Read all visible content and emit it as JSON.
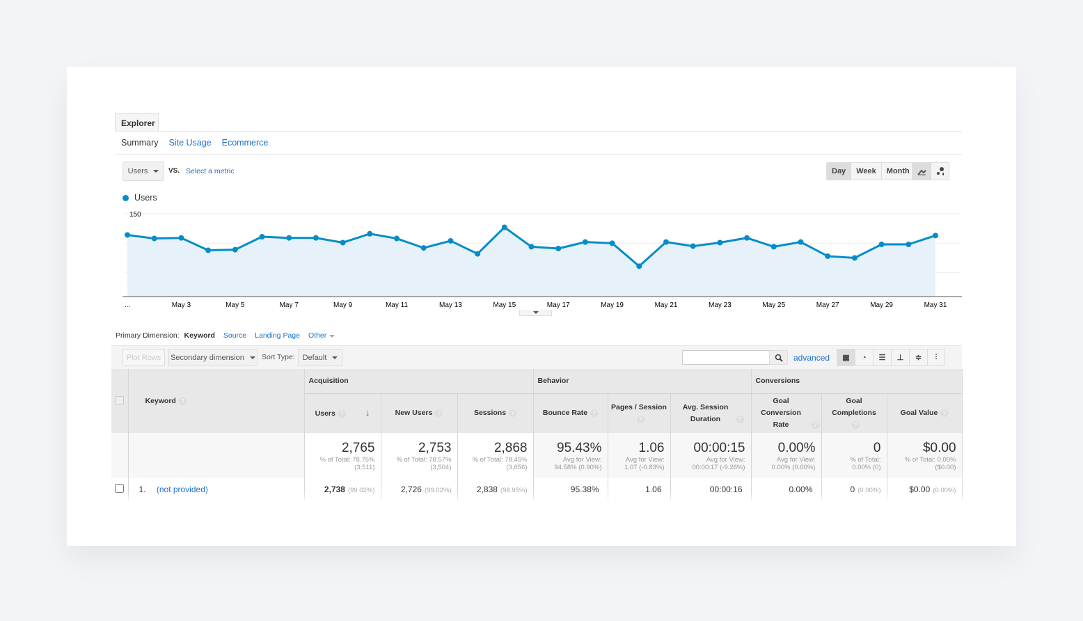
{
  "explorer_tab": "Explorer",
  "subtabs": {
    "summary": "Summary",
    "site_usage": "Site Usage",
    "ecommerce": "Ecommerce"
  },
  "metric": {
    "selected": "Users",
    "vs": "VS.",
    "select": "Select a metric"
  },
  "time": {
    "day": "Day",
    "week": "Week",
    "month": "Month",
    "active": "Day"
  },
  "chart_icons": [
    "line-chart-icon",
    "motion-chart-icon"
  ],
  "legend": "Users",
  "accent": "#058dc7",
  "chart_data": {
    "type": "area",
    "series": [
      {
        "name": "Users",
        "values": [
          114,
          108,
          109,
          88,
          89,
          111,
          109,
          109,
          101,
          116,
          108,
          92,
          104,
          82,
          127,
          94,
          91,
          102,
          100,
          61,
          102,
          95,
          101,
          109,
          94,
          102,
          78,
          75,
          98,
          98,
          113
        ]
      }
    ],
    "x": [
      "May 1",
      "May 2",
      "May 3",
      "May 4",
      "May 5",
      "May 6",
      "May 7",
      "May 8",
      "May 9",
      "May 10",
      "May 11",
      "May 12",
      "May 13",
      "May 14",
      "May 15",
      "May 16",
      "May 17",
      "May 18",
      "May 19",
      "May 20",
      "May 21",
      "May 22",
      "May 23",
      "May 24",
      "May 25",
      "May 26",
      "May 27",
      "May 28",
      "May 29",
      "May 30",
      "May 31"
    ],
    "x_tick_labels": [
      "...",
      "May 3",
      "May 5",
      "May 7",
      "May 9",
      "May 11",
      "May 13",
      "May 15",
      "May 17",
      "May 19",
      "May 21",
      "May 23",
      "May 25",
      "May 27",
      "May 29",
      "May 31"
    ],
    "y_ticks": [
      50,
      100,
      150
    ],
    "ylim": [
      0,
      150
    ],
    "grid": true,
    "legend": "top-left"
  },
  "dimension": {
    "label": "Primary Dimension:",
    "active": "Keyword",
    "options": [
      "Source",
      "Landing Page",
      "Other"
    ]
  },
  "toolbar": {
    "plot_rows": "Plot Rows",
    "secondary": "Secondary dimension",
    "sort_label": "Sort Type:",
    "sort_value": "Default",
    "search_placeholder": "",
    "advanced": "advanced",
    "view_icons": [
      "grid-view-icon",
      "pie-view-icon",
      "bar-view-icon",
      "comparison-view-icon",
      "term-cloud-icon",
      "pivot-view-icon"
    ]
  },
  "table": {
    "groups": {
      "acquisition": "Acquisition",
      "behavior": "Behavior",
      "conversions": "Conversions"
    },
    "dim_header": "Keyword",
    "columns": [
      "Users",
      "New Users",
      "Sessions",
      "Bounce Rate",
      "Pages / Session",
      "Avg. Session Duration",
      "Goal Conversion Rate",
      "Goal Completions",
      "Goal Value"
    ],
    "totals": [
      {
        "value": "2,765",
        "sub1": "% of Total: 78.75%",
        "sub2": "(3,511)"
      },
      {
        "value": "2,753",
        "sub1": "% of Total: 78.57%",
        "sub2": "(3,504)"
      },
      {
        "value": "2,868",
        "sub1": "% of Total: 78.45%",
        "sub2": "(3,656)"
      },
      {
        "value": "95.43%",
        "sub1": "Avg for View:",
        "sub2": "94.58% (0.90%)"
      },
      {
        "value": "1.06",
        "sub1": "Avg for View:",
        "sub2": "1.07 (-0.83%)"
      },
      {
        "value": "00:00:15",
        "sub1": "Avg for View:",
        "sub2": "00:00:17 (-9.26%)"
      },
      {
        "value": "0.00%",
        "sub1": "Avg for View:",
        "sub2": "0.00% (0.00%)"
      },
      {
        "value": "0",
        "sub1": "% of Total:",
        "sub2": "0.00% (0)"
      },
      {
        "value": "$0.00",
        "sub1": "% of Total: 0.00%",
        "sub2": "($0.00)"
      }
    ],
    "rows": [
      {
        "index": "1.",
        "keyword": "(not provided)",
        "cells": [
          {
            "v": "2,738",
            "p": "(99.02%)"
          },
          {
            "v": "2,726",
            "p": "(99.02%)"
          },
          {
            "v": "2,838",
            "p": "(98.95%)"
          },
          {
            "v": "95.38%",
            "p": ""
          },
          {
            "v": "1.06",
            "p": ""
          },
          {
            "v": "00:00:16",
            "p": ""
          },
          {
            "v": "0.00%",
            "p": ""
          },
          {
            "v": "0",
            "p": "(0.00%)"
          },
          {
            "v": "$0.00",
            "p": "(0.00%)"
          }
        ]
      }
    ]
  }
}
